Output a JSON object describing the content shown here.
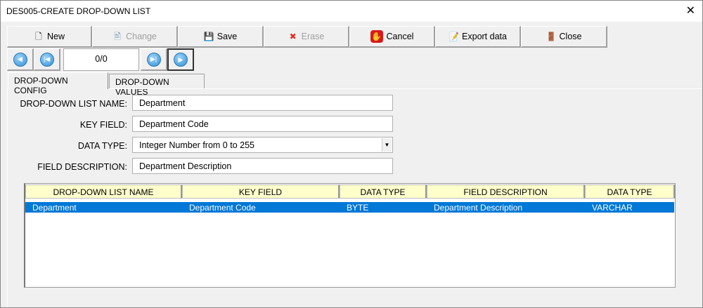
{
  "window": {
    "title": "DES005-CREATE DROP-DOWN LIST",
    "close": "✕"
  },
  "toolbar": [
    {
      "label": "New",
      "icon": "new-document-icon",
      "glyph": "🗋",
      "enabled": true
    },
    {
      "label": "Change",
      "icon": "edit-document-icon",
      "glyph": "🖹",
      "enabled": false
    },
    {
      "label": "Save",
      "icon": "save-icon",
      "glyph": "💾",
      "enabled": true
    },
    {
      "label": "Erase",
      "icon": "erase-x-icon",
      "glyph": "✖",
      "enabled": false
    },
    {
      "label": "Cancel",
      "icon": "stop-hand-icon",
      "glyph": "✋",
      "enabled": true
    },
    {
      "label": "Export data",
      "icon": "export-icon",
      "glyph": "📝",
      "enabled": true
    },
    {
      "label": "Close",
      "icon": "exit-door-icon",
      "glyph": "🚪",
      "enabled": true
    }
  ],
  "nav": {
    "counter": "0/0",
    "prev": "◀",
    "first": "|◀",
    "last": "▶|",
    "next": "▶"
  },
  "tabs": [
    "DROP-DOWN CONFIG",
    "DROP-DOWN VALUES"
  ],
  "form": {
    "name_label": "DROP-DOWN LIST NAME:",
    "name_value": "Department",
    "key_label": "KEY FIELD:",
    "key_value": "Department Code",
    "type_label": "DATA TYPE:",
    "type_value": "Integer Number from 0 to 255",
    "desc_label": "FIELD DESCRIPTION:",
    "desc_value": "Department Description"
  },
  "grid": {
    "columns": [
      "DROP-DOWN LIST NAME",
      "KEY FIELD",
      "DATA TYPE",
      "FIELD DESCRIPTION",
      "DATA TYPE"
    ],
    "rows": [
      [
        "Department",
        "Department Code",
        "BYTE",
        "Department Description",
        "VARCHAR"
      ]
    ]
  },
  "colors": {
    "selection": "#0078d7",
    "header": "#ffffcc"
  }
}
